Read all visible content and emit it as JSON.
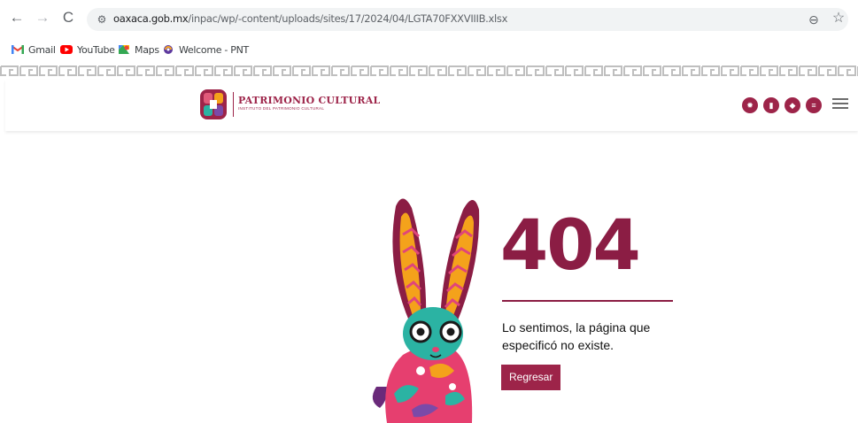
{
  "browser": {
    "url_domain": "oaxaca.gob.mx",
    "url_path": "/inpac/wp/-content/uploads/sites/17/2024/04/LGTA70FXXVIIIB.xlsx",
    "bookmarks": [
      {
        "label": "Gmail",
        "icon": "gmail-icon"
      },
      {
        "label": "YouTube",
        "icon": "youtube-icon"
      },
      {
        "label": "Maps",
        "icon": "maps-icon"
      },
      {
        "label": "Welcome - PNT",
        "icon": "pnt-icon"
      }
    ]
  },
  "site": {
    "logo_title": "PATRIMONIO CULTURAL",
    "logo_subtitle": "INSTITUTO DEL PATRIMONIO CULTURAL",
    "header_icons": [
      "gear-icon",
      "book-icon",
      "shield-icon",
      "list-icon",
      "menu-icon"
    ],
    "brand_color": "#9d2449"
  },
  "error": {
    "code": "404",
    "message": "Lo sentimos, la página que especificó no existe.",
    "button_label": "Regresar"
  }
}
